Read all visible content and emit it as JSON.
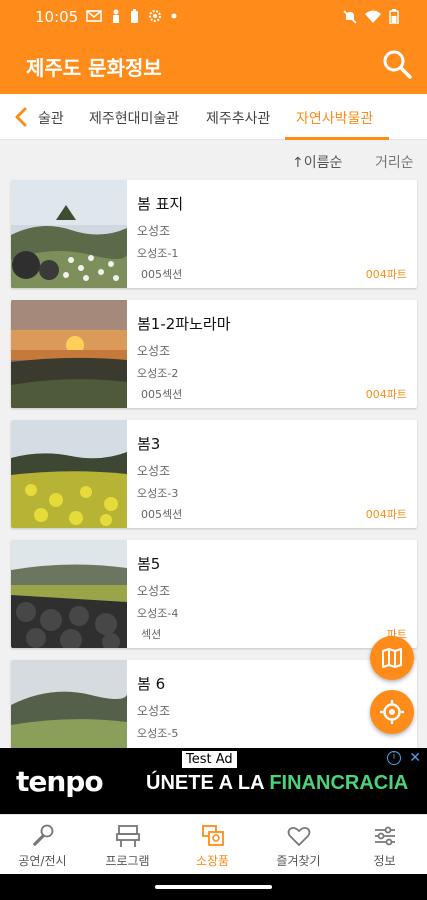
{
  "status_bar": {
    "time": "10:05"
  },
  "app_bar": {
    "title": "제주도 문화정보"
  },
  "tabs": [
    {
      "label": "술관"
    },
    {
      "label": "제주현대미술관"
    },
    {
      "label": "제주추사관"
    },
    {
      "label": "자연사박물관"
    }
  ],
  "sort": {
    "by_name": "↑이름순",
    "by_distance": "거리순"
  },
  "items": [
    {
      "title": "봄 표지",
      "author": "오성조",
      "code": "오성조-1",
      "section": "005섹션",
      "part": "004파트"
    },
    {
      "title": "봄1-2파노라마",
      "author": "오성조",
      "code": "오성조-2",
      "section": "005섹션",
      "part": "004파트"
    },
    {
      "title": "봄3",
      "author": "오성조",
      "code": "오성조-3",
      "section": "005섹션",
      "part": "004파트"
    },
    {
      "title": "봄5",
      "author": "오성조",
      "code": "오성조-4",
      "section": "섹션",
      "part": "파트"
    },
    {
      "title": "봄 6",
      "author": "오성조",
      "code": "오성조-5",
      "section": "",
      "part": ""
    }
  ],
  "ad": {
    "label": "Test Ad",
    "brand": "tenpo",
    "slogan_white": "ÚNETE A LA ",
    "slogan_green": "FINANCRACIA"
  },
  "bottom_nav": [
    {
      "label": "공연/전시",
      "icon": "microphone-icon",
      "active": false
    },
    {
      "label": "프로그램",
      "icon": "program-icon",
      "active": false
    },
    {
      "label": "소장품",
      "icon": "collection-icon",
      "active": true
    },
    {
      "label": "즐겨찾기",
      "icon": "heart-icon",
      "active": false
    },
    {
      "label": "정보",
      "icon": "settings-sliders-icon",
      "active": false
    }
  ],
  "colors": {
    "accent": "#ff8c1a",
    "ad_green": "#4bd37a"
  }
}
